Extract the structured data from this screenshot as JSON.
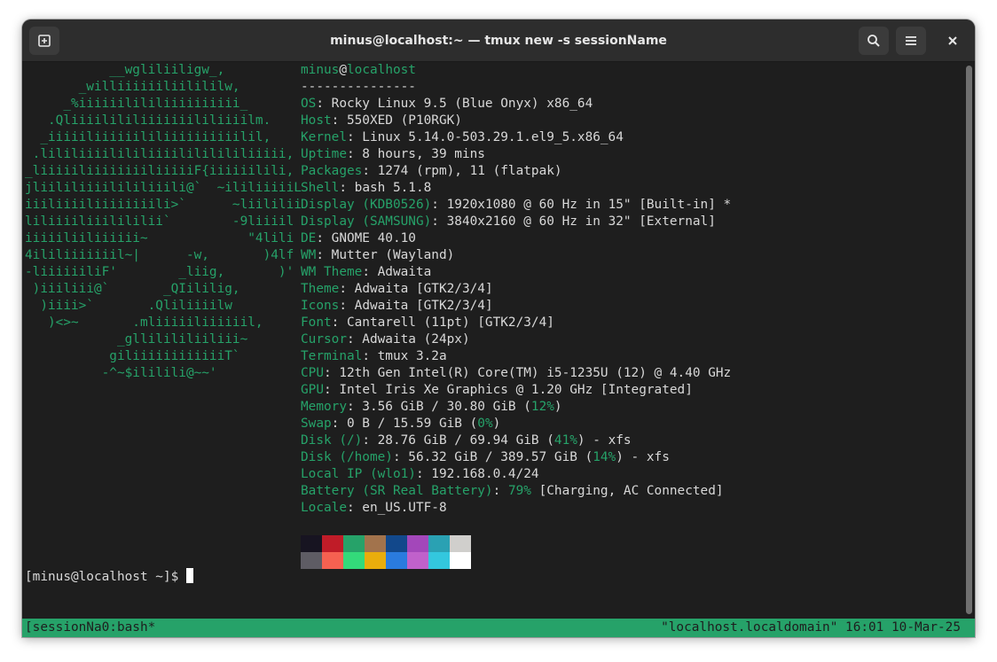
{
  "window": {
    "title": "minus@localhost:~ — tmux new -s sessionName"
  },
  "titlebar_buttons": {
    "new_tab_icon": "new-tab-icon",
    "search_icon": "search-icon",
    "menu_icon": "hamburger-menu-icon",
    "close_icon": "close-icon"
  },
  "logo_lines": [
    "           __wgliliiligw_,",
    "       _williiiiiiliilililw,",
    "     _%iiiiiilililiiiiiiiiii_",
    "   .Qliiiilililiiiiiiililiiiilm.",
    "  _iiiiiliiiiiililiiiiiiiiiilil,",
    " .lililiiiilililiiiilililililiiiii,",
    "_liiiiiliiiiiiiiliiiiiF{iiiiiilili,",
    "jliililiiiilililiiili@`  ~ililiiiiiL",
    "iiiliiiiliiiiiiiili>`      ~liililii",
    "liliiiiliiilililii`        -9liiiil",
    "iiiiiliiliiiiii~             \"4lili",
    "4ililiiiiiiil~|      -w,       )4lf",
    "-liiiiiiliF'        _liig,       )'",
    " )iiiliii@`       _QIililig,",
    "  )iiii>`       .Qliliiiilw",
    "   )<>~       .mliiiiiliiiiiil,",
    "            _gllilililiiliii~",
    "           giliiiiiiiiiiiiT`",
    "          -^~$ililili@~~'"
  ],
  "info": {
    "user": "minus",
    "at": "@",
    "host": "localhost",
    "separator": "---------------",
    "rows": [
      {
        "key": "OS",
        "value": ": Rocky Linux 9.5 (Blue Onyx) x86_64"
      },
      {
        "key": "Host",
        "value": ": 550XED (P10RGK)"
      },
      {
        "key": "Kernel",
        "value": ": Linux 5.14.0-503.29.1.el9_5.x86_64"
      },
      {
        "key": "Uptime",
        "value": ": 8 hours, 39 mins"
      },
      {
        "key": "Packages",
        "value": ": 1274 (rpm), 11 (flatpak)"
      },
      {
        "key": "Shell",
        "value": ": bash 5.1.8"
      },
      {
        "key": "Display (KDB0526)",
        "value": ": 1920x1080 @ 60 Hz in 15\" [Built-in] *"
      },
      {
        "key": "Display (SAMSUNG)",
        "value": ": 3840x2160 @ 60 Hz in 32\" [External]"
      },
      {
        "key": "DE",
        "value": ": GNOME 40.10"
      },
      {
        "key": "WM",
        "value": ": Mutter (Wayland)"
      },
      {
        "key": "WM Theme",
        "value": ": Adwaita"
      },
      {
        "key": "Theme",
        "value": ": Adwaita [GTK2/3/4]"
      },
      {
        "key": "Icons",
        "value": ": Adwaita [GTK2/3/4]"
      },
      {
        "key": "Font",
        "value": ": Cantarell (11pt) [GTK2/3/4]"
      },
      {
        "key": "Cursor",
        "value": ": Adwaita (24px)"
      },
      {
        "key": "Terminal",
        "value": ": tmux 3.2a"
      },
      {
        "key": "CPU",
        "value": ": 12th Gen Intel(R) Core(TM) i5-1235U (12) @ 4.40 GHz"
      },
      {
        "key": "GPU",
        "value": ": Intel Iris Xe Graphics @ 1.20 GHz [Integrated]"
      },
      {
        "key": "Memory",
        "value": ": 3.56 GiB / 30.80 GiB (",
        "pct": "12%",
        "tail": ")"
      },
      {
        "key": "Swap",
        "value": ": 0 B / 15.59 GiB (",
        "pct": "0%",
        "tail": ")"
      },
      {
        "key": "Disk (/)",
        "value": ": 28.76 GiB / 69.94 GiB (",
        "pct": "41%",
        "tail": ") - xfs"
      },
      {
        "key": "Disk (/home)",
        "value": ": 56.32 GiB / 389.57 GiB (",
        "pct": "14%",
        "tail": ") - xfs"
      },
      {
        "key": "Local IP (wlo1)",
        "value": ": 192.168.0.4/24"
      },
      {
        "key": "Battery (SR Real Battery)",
        "value": ": ",
        "pct": "79%",
        "tail": " [Charging, AC Connected]"
      },
      {
        "key": "Locale",
        "value": ": en_US.UTF-8"
      }
    ]
  },
  "palette": {
    "normal": [
      "#171421",
      "#c01c28",
      "#26a269",
      "#a2734c",
      "#12488b",
      "#a347ba",
      "#2aa1b3",
      "#d0cfcc"
    ],
    "bright": [
      "#5e5c64",
      "#f66151",
      "#33da7a",
      "#e9ad0c",
      "#2a7bde",
      "#c061cb",
      "#33c7de",
      "#ffffff"
    ]
  },
  "prompt": "[minus@localhost ~]$ ",
  "statusbar": {
    "left": "[sessionNa0:bash*",
    "right": "\"localhost.localdomain\" 16:01 10-Mar-25"
  },
  "colors": {
    "accent": "#26a269",
    "background": "#1e1e1e",
    "foreground": "#d8d8d8"
  }
}
